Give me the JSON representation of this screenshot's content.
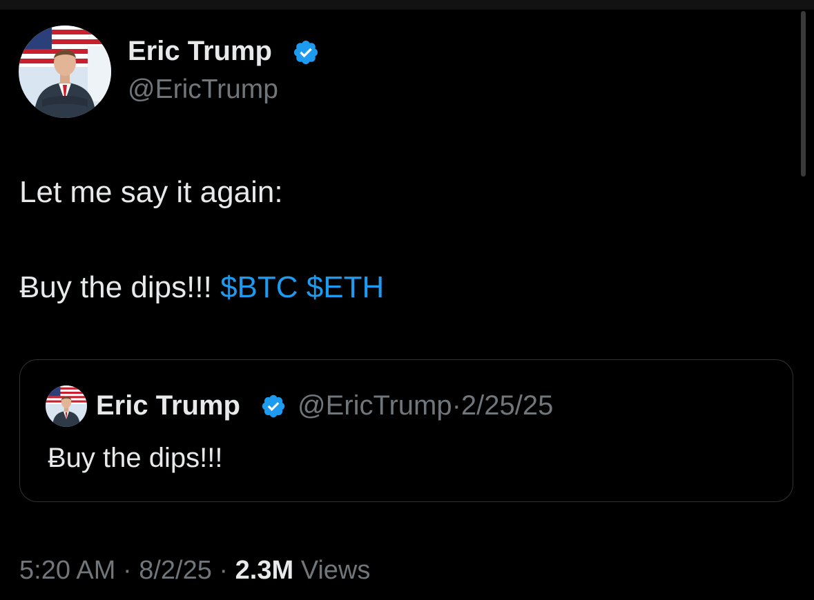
{
  "author": {
    "name": "Eric Trump",
    "handle": "@EricTrump",
    "verified": true
  },
  "tweet": {
    "line1": "Let me say it again:",
    "line2_text": "Ƀuy the dips!!!",
    "cashtags": [
      "$BTC",
      "$ETH"
    ]
  },
  "quoted_tweet": {
    "name": "Eric Trump",
    "handle": "@EricTrump",
    "separator": "·",
    "date": "2/25/25",
    "text": "Ƀuy the dips!!!"
  },
  "footer": {
    "time": "5:20 AM",
    "separator": "·",
    "date": "8/2/25",
    "views_count": "2.3M",
    "views_label": "Views"
  },
  "colors": {
    "background": "#000000",
    "text_primary": "#e7e9ea",
    "text_secondary": "#71767b",
    "accent": "#1d9bf0",
    "border": "#2f3336"
  },
  "icons": {
    "verified": "verified-badge-icon"
  }
}
